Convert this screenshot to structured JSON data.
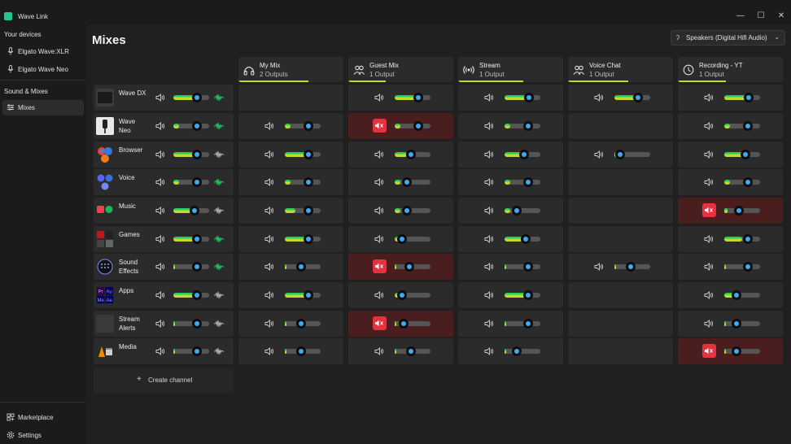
{
  "app": {
    "title": "Wave Link"
  },
  "window": {
    "minimize": "—",
    "maximize": "☐",
    "close": "✕"
  },
  "sidebar": {
    "devices_heading": "Your devices",
    "devices": [
      {
        "label": "Elgato Wave:XLR",
        "icon": "microphone-icon"
      },
      {
        "label": "Elgato Wave Neo",
        "icon": "microphone-icon"
      }
    ],
    "sound_heading": "Sound & Mixes",
    "mixes_item": {
      "label": "Mixes",
      "icon": "mixer-icon"
    },
    "bottom": [
      {
        "label": "Marketplace",
        "icon": "marketplace-icon"
      },
      {
        "label": "Settings",
        "icon": "gear-icon"
      }
    ]
  },
  "main": {
    "title": "Mixes",
    "output_device": "Speakers (Digital Hifi Audio)",
    "create_channel": "Create channel"
  },
  "mixes": [
    {
      "name": "My Mix",
      "outputs": "2 Outputs",
      "icon": "headphones-icon",
      "level": 0.67
    },
    {
      "name": "Guest Mix",
      "outputs": "1 Output",
      "icon": "group-icon",
      "level": 0.36
    },
    {
      "name": "Stream",
      "outputs": "1 Output",
      "icon": "broadcast-icon",
      "level": 0.62
    },
    {
      "name": "Voice Chat",
      "outputs": "1 Output",
      "icon": "group-icon",
      "level": 0.57
    },
    {
      "name": "Recording - YT",
      "outputs": "1 Output",
      "icon": "recording-icon",
      "level": 0.46
    }
  ],
  "channels": [
    {
      "name": "Wave DX",
      "thumb": "dark",
      "level": 0.65,
      "fill": 0.6,
      "wave": "green",
      "mixes": [
        null,
        {
          "v": 0.65,
          "f": 0.6
        },
        {
          "v": 0.68,
          "f": 0.6
        },
        {
          "v": 0.65,
          "f": 0.6
        },
        {
          "v": 0.68,
          "f": 0.62
        }
      ]
    },
    {
      "name": "Wave\nNeo",
      "thumb": "mic",
      "level": 0.65,
      "fill": 0.15,
      "wave": "green",
      "mixes": [
        {
          "v": 0.65,
          "f": 0.15
        },
        {
          "v": 0.65,
          "f": 0.15,
          "m": true
        },
        {
          "v": 0.65,
          "f": 0.15
        },
        null,
        {
          "v": 0.65,
          "f": 0.15
        }
      ]
    },
    {
      "name": "Browser",
      "thumb": "browser",
      "level": 0.65,
      "fill": 0.7,
      "wave": "gray",
      "mixes": [
        {
          "v": 0.65,
          "f": 0.7
        },
        {
          "v": 0.45,
          "f": 0.35
        },
        {
          "v": 0.55,
          "f": 0.5
        },
        {
          "v": 0.15,
          "f": 0.1
        },
        {
          "v": 0.6,
          "f": 0.7
        }
      ]
    },
    {
      "name": "Voice",
      "thumb": "voice",
      "level": 0.65,
      "fill": 0.15,
      "wave": "green",
      "mixes": [
        {
          "v": 0.65,
          "f": 0.15
        },
        {
          "v": 0.35,
          "f": 0.15
        },
        {
          "v": 0.65,
          "f": 0.15
        },
        null,
        {
          "v": 0.65,
          "f": 0.15
        }
      ]
    },
    {
      "name": "Music",
      "thumb": "music",
      "level": 0.6,
      "fill": 0.5,
      "wave": "gray",
      "mixes": [
        {
          "v": 0.65,
          "f": 0.3
        },
        {
          "v": 0.35,
          "f": 0.15
        },
        {
          "v": 0.35,
          "f": 0.15
        },
        null,
        {
          "v": 0.4,
          "f": 0.1,
          "m": true
        }
      ]
    },
    {
      "name": "Games",
      "thumb": "games",
      "level": 0.65,
      "fill": 0.7,
      "wave": "green",
      "mixes": [
        {
          "v": 0.65,
          "f": 0.7
        },
        {
          "v": 0.2,
          "f": 0.15
        },
        {
          "v": 0.6,
          "f": 0.5
        },
        null,
        {
          "v": 0.65,
          "f": 0.5
        }
      ]
    },
    {
      "name": "Sound\nEffects",
      "thumb": "effects",
      "level": 0.65,
      "fill": 0.05,
      "wave": "green",
      "mixes": [
        {
          "v": 0.45,
          "f": 0.05
        },
        {
          "v": 0.4,
          "f": 0.05,
          "m": true
        },
        {
          "v": 0.65,
          "f": 0.05
        },
        {
          "v": 0.45,
          "f": 0.05
        },
        {
          "v": 0.65,
          "f": 0.05
        }
      ]
    },
    {
      "name": "Apps",
      "thumb": "apps",
      "level": 0.65,
      "fill": 0.7,
      "wave": "gray",
      "mixes": [
        {
          "v": 0.65,
          "f": 0.7
        },
        {
          "v": 0.2,
          "f": 0.15
        },
        {
          "v": 0.65,
          "f": 0.7
        },
        null,
        {
          "v": 0.35,
          "f": 0.3
        }
      ]
    },
    {
      "name": "Stream\nAlerts",
      "thumb": "blank",
      "level": 0.65,
      "fill": 0.05,
      "wave": "gray",
      "mixes": [
        {
          "v": 0.45,
          "f": 0.05
        },
        {
          "v": 0.25,
          "f": 0.05,
          "m": true
        },
        {
          "v": 0.65,
          "f": 0.05
        },
        null,
        {
          "v": 0.35,
          "f": 0.05
        }
      ]
    },
    {
      "name": "Media",
      "thumb": "media",
      "level": 0.65,
      "fill": 0.05,
      "wave": "gray",
      "mixes": [
        {
          "v": 0.45,
          "f": 0.05
        },
        {
          "v": 0.45,
          "f": 0.05
        },
        {
          "v": 0.35,
          "f": 0.05
        },
        null,
        {
          "v": 0.35,
          "f": 0.05,
          "m": true
        }
      ]
    }
  ],
  "colors": {
    "accent": "#3fa9f5",
    "level_green": "#1fd160",
    "level_yellow": "#c6d82b",
    "mute_red": "#e5323f",
    "muted_cell": "#4a1d1f"
  }
}
